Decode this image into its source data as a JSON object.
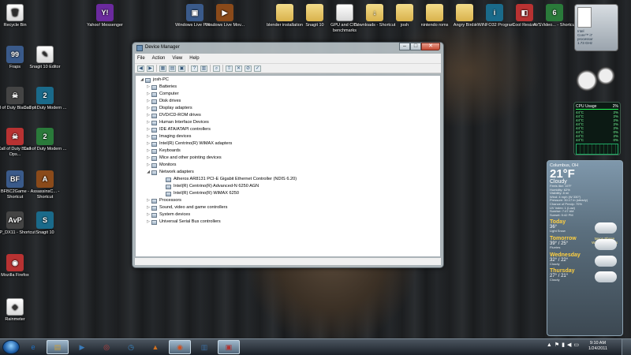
{
  "desktop_icons": [
    {
      "label": "Recycle Bin",
      "glyph": "🗑",
      "kind": "doc"
    },
    {
      "label": "Yahoo! Messenger",
      "glyph": "Y!",
      "kind": "yahoo"
    },
    {
      "label": "Windows Live Pho...",
      "glyph": "▣",
      "kind": "app"
    },
    {
      "label": "Windows Live Mov...",
      "glyph": "▶",
      "kind": "app"
    },
    {
      "label": "blender installation",
      "glyph": "",
      "kind": "folder"
    },
    {
      "label": "Snagit 10",
      "glyph": "",
      "kind": "folder"
    },
    {
      "label": "GPU and CPU benchmarks",
      "glyph": "",
      "kind": "doc"
    },
    {
      "label": "Downloads - Shortcut",
      "glyph": "↓",
      "kind": "folder"
    },
    {
      "label": "josh",
      "glyph": "",
      "kind": "folder"
    },
    {
      "label": "nintendo roms",
      "glyph": "",
      "kind": "folder"
    },
    {
      "label": "Angry Birds",
      "glyph": "",
      "kind": "folder"
    },
    {
      "label": "HWiNFO32 Program",
      "glyph": "i",
      "kind": "app"
    },
    {
      "label": "Cool Resizer",
      "glyph": "◧",
      "kind": "app"
    },
    {
      "label": "AVSVideo... - Shortcut",
      "glyph": "6",
      "kind": "app"
    },
    {
      "label": "Fraps",
      "glyph": "99",
      "kind": "app"
    },
    {
      "label": "Snagit 10 Editor",
      "glyph": "✎",
      "kind": "doc"
    },
    {
      "label": "Call of Duty Black Ops",
      "glyph": "☠",
      "kind": "app"
    },
    {
      "label": "Call of Duty Modern ...",
      "glyph": "2",
      "kind": "app"
    },
    {
      "label": "Call of Duty Black Ops...",
      "glyph": "☠",
      "kind": "app"
    },
    {
      "label": "Call of Duty Modern ...",
      "glyph": "2",
      "kind": "app"
    },
    {
      "label": "BFBC2Game - Shortcut",
      "glyph": "BF",
      "kind": "app"
    },
    {
      "label": "AssassinsC... - Shortcut",
      "glyph": "A",
      "kind": "app"
    },
    {
      "label": "AvP_DX11 - Shortcut",
      "glyph": "AvP",
      "kind": "app"
    },
    {
      "label": "Snagit 10",
      "glyph": "S",
      "kind": "app"
    },
    {
      "label": "Mozilla Firefox",
      "glyph": "◉",
      "kind": "app"
    },
    {
      "label": "Rainmeter",
      "glyph": "◆",
      "kind": "doc"
    }
  ],
  "window": {
    "title": "Device Manager",
    "menu": [
      "File",
      "Action",
      "View",
      "Help"
    ],
    "tree": [
      {
        "label": "josh-PC",
        "level": 0,
        "toggle": "◢"
      },
      {
        "label": "Batteries",
        "level": 1,
        "toggle": "▷"
      },
      {
        "label": "Computer",
        "level": 1,
        "toggle": "▷"
      },
      {
        "label": "Disk drives",
        "level": 1,
        "toggle": "▷"
      },
      {
        "label": "Display adapters",
        "level": 1,
        "toggle": "▷"
      },
      {
        "label": "DVD/CD-ROM drives",
        "level": 1,
        "toggle": "▷"
      },
      {
        "label": "Human Interface Devices",
        "level": 1,
        "toggle": "▷"
      },
      {
        "label": "IDE ATA/ATAPI controllers",
        "level": 1,
        "toggle": "▷"
      },
      {
        "label": "Imaging devices",
        "level": 1,
        "toggle": "▷"
      },
      {
        "label": "Intel(R) Centrino(R) WiMAX adapters",
        "level": 1,
        "toggle": "▷"
      },
      {
        "label": "Keyboards",
        "level": 1,
        "toggle": "▷"
      },
      {
        "label": "Mice and other pointing devices",
        "level": 1,
        "toggle": "▷"
      },
      {
        "label": "Monitors",
        "level": 1,
        "toggle": "▷"
      },
      {
        "label": "Network adapters",
        "level": 1,
        "toggle": "◢"
      },
      {
        "label": "Atheros AR8131 PCI-E Gigabit Ethernet Controller (NDIS 6.20)",
        "level": 2,
        "toggle": ""
      },
      {
        "label": "Intel(R) Centrino(R) Advanced-N 6250 AGN",
        "level": 2,
        "toggle": ""
      },
      {
        "label": "Intel(R) Centrino(R) WiMAX 6250",
        "level": 2,
        "toggle": ""
      },
      {
        "label": "Processors",
        "level": 1,
        "toggle": "▷"
      },
      {
        "label": "Sound, video and game controllers",
        "level": 1,
        "toggle": "▷"
      },
      {
        "label": "System devices",
        "level": 1,
        "toggle": "▷"
      },
      {
        "label": "Universal Serial Bus controllers",
        "level": 1,
        "toggle": "▷"
      }
    ]
  },
  "cpu_id": {
    "line1": "Intel",
    "line2": "Core™ i7",
    "line3": "processor",
    "line4": "1.73 GHz"
  },
  "cpu_usage": {
    "title": "CPU Usage",
    "total": "2%",
    "cores": [
      {
        "temp": "44°C",
        "pct": "2%"
      },
      {
        "temp": "44°C",
        "pct": "2%"
      },
      {
        "temp": "44°C",
        "pct": "2%"
      },
      {
        "temp": "44°C",
        "pct": "2%"
      },
      {
        "temp": "44°C",
        "pct": "2%"
      },
      {
        "temp": "44°C",
        "pct": "0%"
      },
      {
        "temp": "44°C",
        "pct": "2%"
      },
      {
        "temp": "44°C",
        "pct": "0%"
      }
    ]
  },
  "weather": {
    "city": "Columbus, OH",
    "temp": "21°F",
    "condition": "Cloudy",
    "details": [
      "Feels like: 15°F",
      "Humidity: 62%",
      "Visibility: 8 mi",
      "Wind: 4 mph (W 330°)",
      "Pressure: 30.17 in (steady)",
      "Chance of Precip: 70%",
      "UV Index: 1 (Low)",
      "Sunrise: 7:47 AM",
      "Sunset: 5:42 PM"
    ],
    "moon_label": "Moon Phase",
    "moon_value": "Waxing Gibbous",
    "forecast": [
      {
        "day": "Today",
        "hl": "36°",
        "cond": "Light Snow"
      },
      {
        "day": "Tomorrow",
        "hl": "39° / 25°",
        "cond": "Flurries"
      },
      {
        "day": "Wednesday",
        "hl": "32° / 22°",
        "cond": "Cloudy"
      },
      {
        "day": "Thursday",
        "hl": "27° / 21°",
        "cond": "Cloudy"
      }
    ]
  },
  "taskbar": {
    "pinned": [
      "e",
      "▤",
      "▶",
      "◎",
      "◷",
      "▲",
      "◉",
      "▥",
      "▣"
    ],
    "time": "9:10 AM",
    "date": "1/24/2011"
  }
}
